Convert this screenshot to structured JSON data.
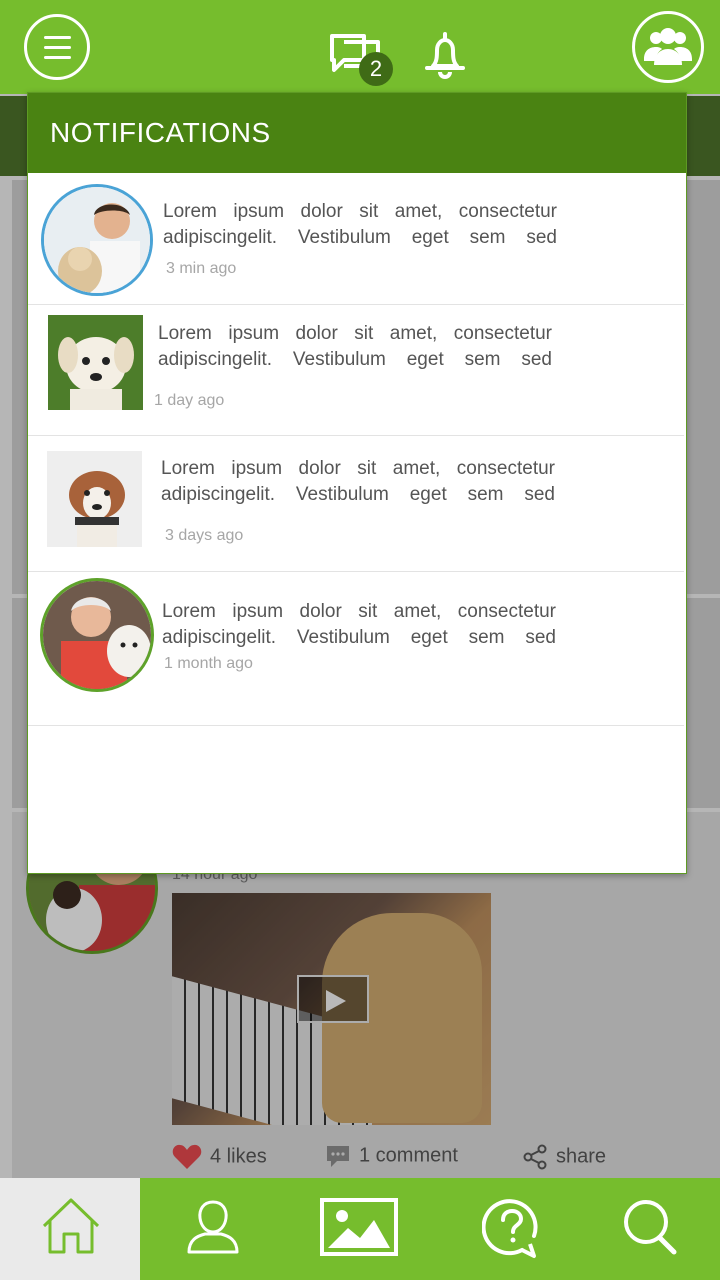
{
  "header": {
    "chat_badge": "2"
  },
  "icons": {
    "menu": "hamburger-icon",
    "chat": "chat-bubbles-icon",
    "bell": "bell-icon",
    "group": "group-users-icon"
  },
  "notifications": {
    "title": "NOTIFICATIONS",
    "items": [
      {
        "text": "Lorem ipsum dolor sit amet, consectetur adipiscingelit. Vestibulum eget sem sed",
        "time": "3 min ago"
      },
      {
        "text": "Lorem ipsum dolor sit amet, consectetur adipiscingelit. Vestibulum eget sem sed",
        "time": "1 day ago"
      },
      {
        "text": "Lorem ipsum dolor sit amet, consectetur adipiscingelit. Vestibulum eget sem sed",
        "time": "3 days ago"
      },
      {
        "text": "Lorem ipsum dolor sit amet, consectetur adipiscingelit. Vestibulum eget sem sed",
        "time": "1 month ago"
      }
    ]
  },
  "feed": {
    "post_time": "14 hour ago",
    "likes": "4 likes",
    "comments": "1 comment",
    "share": "share"
  },
  "bottom_nav": [
    "home-icon",
    "profile-icon",
    "gallery-icon",
    "help-icon",
    "search-icon"
  ],
  "colors": {
    "brand_green": "#76bd2d",
    "header_dark_green": "#4a8312",
    "badge_green": "#3f6b16",
    "like_red": "#e0474c"
  }
}
